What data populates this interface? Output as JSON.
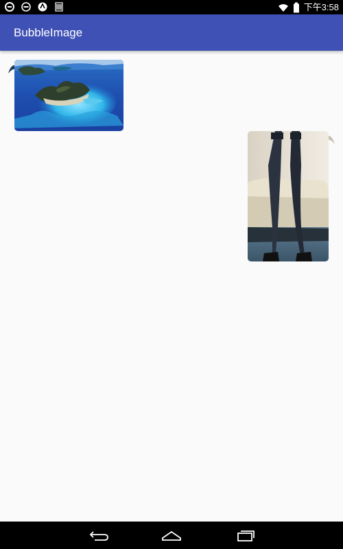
{
  "status_bar": {
    "time": "下午3:58",
    "left_icons": [
      "sync-icon",
      "dnd-icon",
      "vpn-icon",
      "sim-icon"
    ],
    "right_icons": [
      "wifi-icon",
      "battery-icon"
    ]
  },
  "app_bar": {
    "title": "BubbleImage",
    "color": "#3f51b5"
  },
  "messages": [
    {
      "side": "left",
      "image": "island-aerial-photo"
    },
    {
      "side": "right",
      "image": "legs-stockings-photo"
    }
  ],
  "nav_bar": {
    "buttons": [
      "back-icon",
      "home-icon",
      "recents-icon"
    ]
  }
}
